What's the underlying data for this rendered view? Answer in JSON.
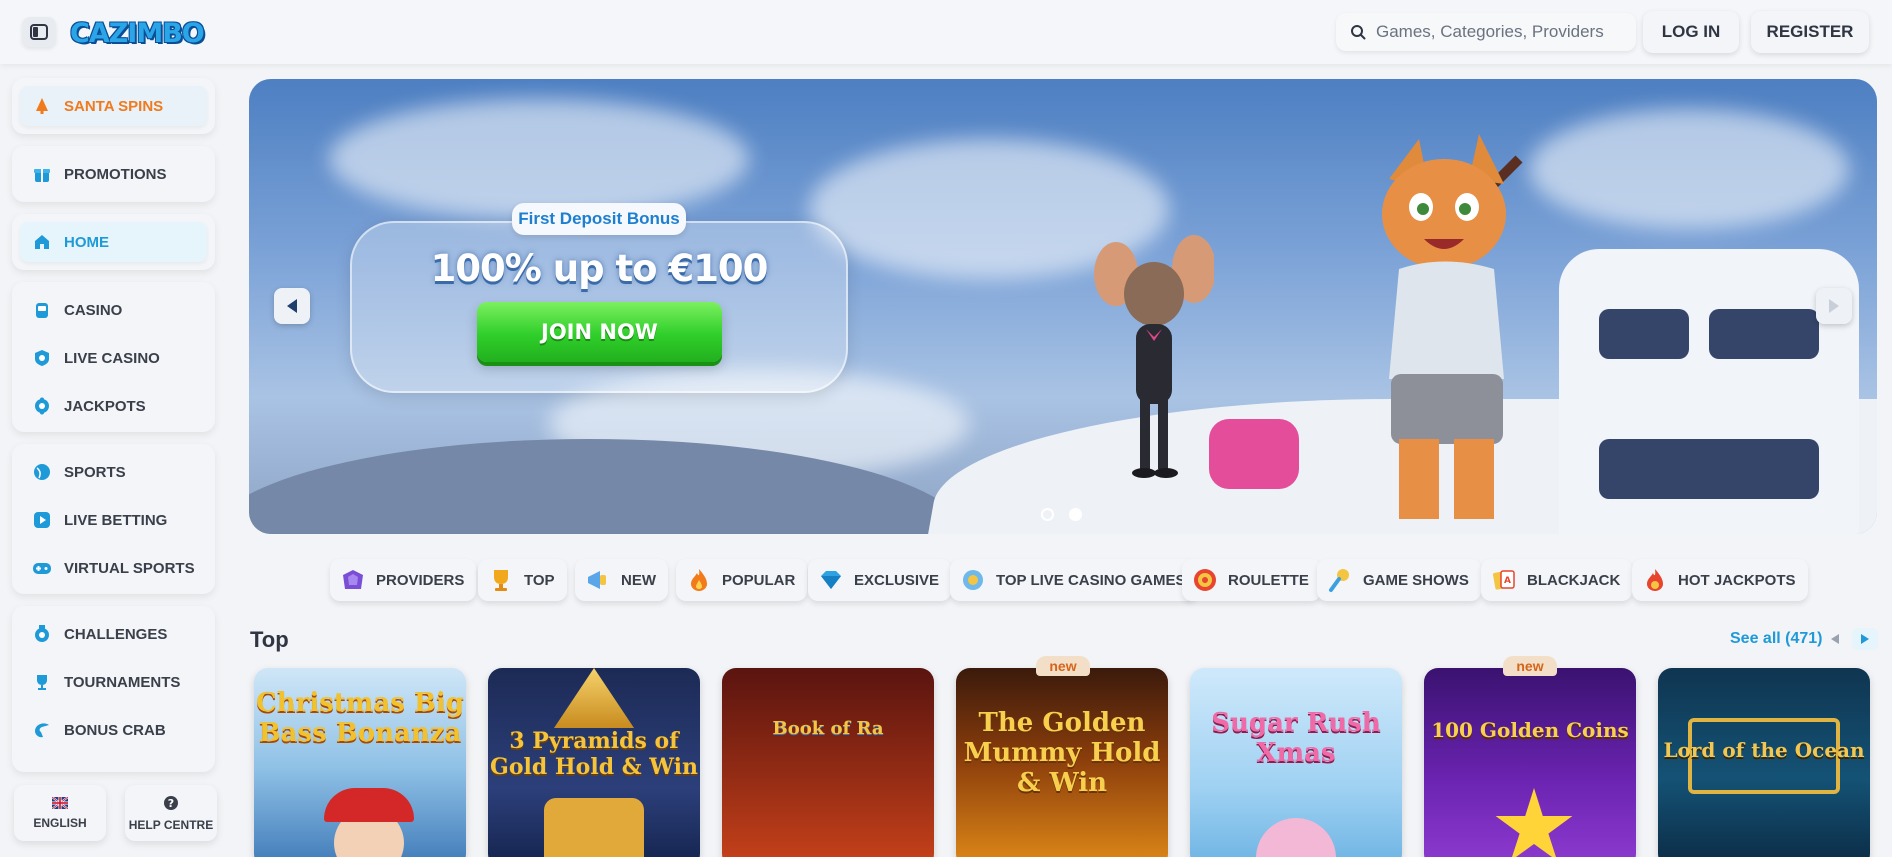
{
  "header": {
    "logo_text": "CAZIMBO",
    "search_placeholder": "Games, Categories, Providers",
    "login_label": "LOG IN",
    "register_label": "REGISTER"
  },
  "sidebar": {
    "santa": "SANTA SPINS",
    "promotions": "PROMOTIONS",
    "home": "HOME",
    "casino": "CASINO",
    "live_casino": "LIVE CASINO",
    "jackpots": "JACKPOTS",
    "sports": "SPORTS",
    "live_betting": "LIVE BETTING",
    "virtual_sports": "VIRTUAL SPORTS",
    "challenges": "CHALLENGES",
    "tournaments": "TOURNAMENTS",
    "bonus_crab": "BONUS CRAB",
    "language": "ENGLISH",
    "help": "HELP CENTRE"
  },
  "hero": {
    "tag": "First Deposit Bonus",
    "amount": "100% up to €100",
    "cta": "JOIN NOW",
    "active_slide": 2,
    "slide_count": 2
  },
  "categories": [
    "PROVIDERS",
    "TOP",
    "NEW",
    "POPULAR",
    "EXCLUSIVE",
    "TOP LIVE CASINO GAMES",
    "ROULETTE",
    "GAME SHOWS",
    "BLACKJACK",
    "HOT JACKPOTS"
  ],
  "games_section": {
    "title": "Top",
    "see_all": "See all (471)",
    "games": [
      {
        "title": "Christmas Big Bass Bonanza",
        "badge": ""
      },
      {
        "title": "3 Pyramids of Gold Hold & Win",
        "badge": ""
      },
      {
        "title": "Book of Ra",
        "badge": ""
      },
      {
        "title": "The Golden Mummy Hold & Win",
        "badge": "new"
      },
      {
        "title": "Sugar Rush Xmas",
        "badge": ""
      },
      {
        "title": "100 Golden Coins",
        "badge": "new"
      },
      {
        "title": "Lord of the Ocean",
        "badge": ""
      }
    ]
  },
  "colors": {
    "accent_blue": "#1e9ad8",
    "accent_orange": "#f07a1c",
    "cta_green": "#2fcf2a",
    "background": "#f2f4f7"
  }
}
